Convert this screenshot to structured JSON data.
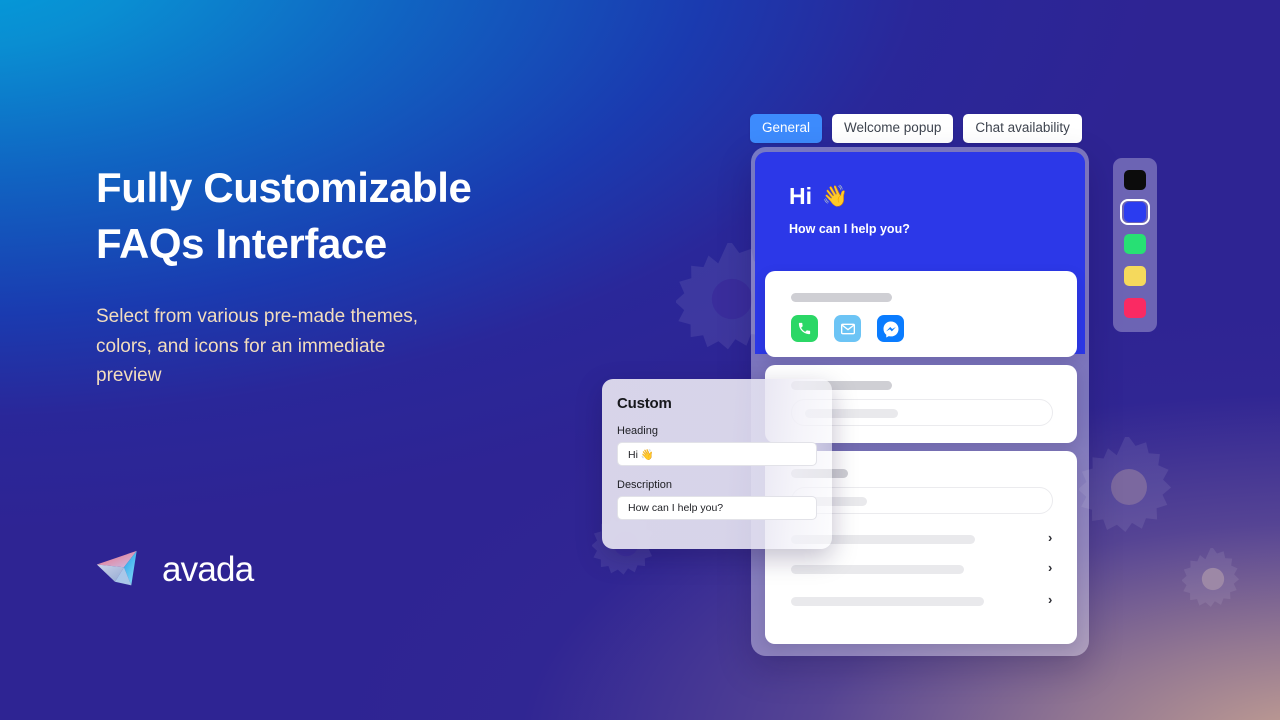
{
  "hero": {
    "headline": "Fully Customizable\nFAQs Interface",
    "subcopy": "Select from various pre-made themes,\ncolors, and icons for an immediate\npreview"
  },
  "brand": {
    "name": "avada",
    "logo_icon": "avada-paper-plane-logo",
    "gradient_pink": "#f4728a",
    "gradient_cyan": "#2fb8f0"
  },
  "tabs": [
    {
      "label": "General",
      "active": true
    },
    {
      "label": "Welcome popup",
      "active": false
    },
    {
      "label": "Chat availability",
      "active": false
    }
  ],
  "widget": {
    "heading": "Hi",
    "heading_emoji": "👋",
    "description": "How can I help you?",
    "header_color": "#2c38e8",
    "contact_icons": [
      {
        "name": "phone-icon",
        "color": "#2bd766"
      },
      {
        "name": "email-icon",
        "color": "#6cc4f5"
      },
      {
        "name": "messenger-icon",
        "color": "#0a7cff"
      }
    ],
    "faq_rows": [
      {
        "chevron": "›"
      },
      {
        "chevron": "›"
      },
      {
        "chevron": "›"
      }
    ]
  },
  "palette": {
    "swatches": [
      {
        "name": "black",
        "color": "#0c0c0c",
        "selected": false
      },
      {
        "name": "blue",
        "color": "#2b3cf0",
        "selected": true
      },
      {
        "name": "green",
        "color": "#27e074",
        "selected": false
      },
      {
        "name": "yellow",
        "color": "#f5d95c",
        "selected": false
      },
      {
        "name": "pink",
        "color": "#fa2a63",
        "selected": false
      }
    ]
  },
  "custom_panel": {
    "title": "Custom",
    "heading_label": "Heading",
    "heading_value": "Hi 👋",
    "description_label": "Description",
    "description_value": "How can I help you?"
  }
}
